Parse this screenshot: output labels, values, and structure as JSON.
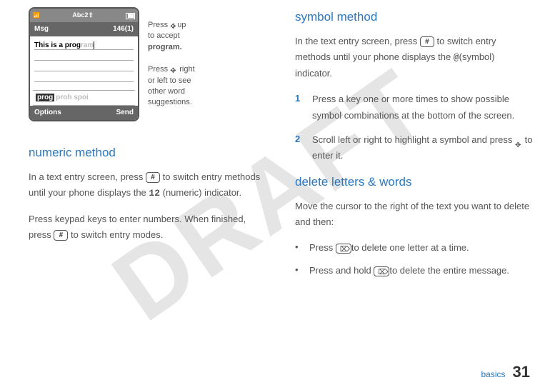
{
  "watermark": "DRAFT",
  "phone": {
    "status_mode": "Abc2⇧",
    "title_left": "Msg",
    "title_right": "146(1)",
    "typed": "This is a prog",
    "typed_suggest": "ram",
    "suggest_selected": "prog",
    "suggest_rest": "proh spoi",
    "left_softkey": "Options",
    "right_softkey": "Send"
  },
  "anno1": {
    "line1": "Press ",
    "line2": "up",
    "line3": "to accept",
    "line4": "program."
  },
  "anno2": {
    "line1": "Press ",
    "line2": " right",
    "line3": "or left to see",
    "line4": "other word",
    "line5": "suggestions."
  },
  "left_col": {
    "h_numeric": "numeric method",
    "p1a": "In a text entry screen, press ",
    "key_hash": "#",
    "p1b": " to switch entry methods until your phone displays the ",
    "ind_numeric": "12",
    "p1c": " (numeric) indicator.",
    "p2a": "Press keypad keys to enter numbers. When finished, press ",
    "p2b": " to switch entry modes."
  },
  "right_col": {
    "h_symbol": "symbol method",
    "p1a": "In the text entry screen, press ",
    "key_hash": "#",
    "p1b": " to switch entry methods until your phone displays the ",
    "ind_symbol": "@",
    "p1c": "(symbol) indicator.",
    "step1_num": "1",
    "step1": "Press a key one or more times to show possible symbol combinations at the bottom of the screen.",
    "step2_num": "2",
    "step2a": "Scroll left or right to highlight a symbol and press ",
    "step2b": " to enter it.",
    "h_delete": "delete letters & words",
    "p2": "Move the cursor to the right of the text you want to delete and then:",
    "b1a": "Press ",
    "b1b": "to delete one letter at a time.",
    "b2a": "Press and hold ",
    "b2b": "to delete the entire message."
  },
  "footer": {
    "label": "basics",
    "page": "31"
  }
}
